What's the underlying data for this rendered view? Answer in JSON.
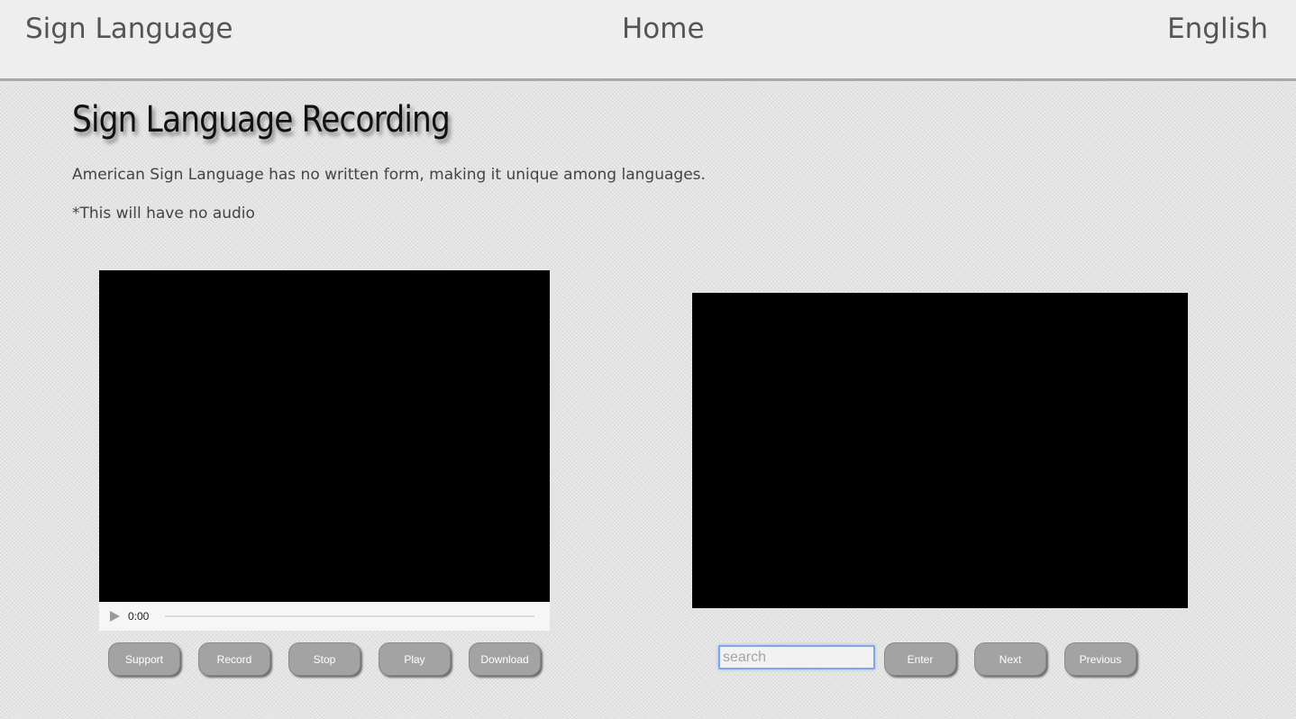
{
  "nav": {
    "brand": "Sign Language",
    "home": "Home",
    "language": "English"
  },
  "header": {
    "title": "Sign Language Recording",
    "intro": "American Sign Language has no written form, making it unique among languages.",
    "note": "*This will have no audio"
  },
  "recorder": {
    "time": "0:00",
    "buttons": {
      "support": "Support",
      "record": "Record",
      "stop": "Stop",
      "play": "Play",
      "download": "Download"
    }
  },
  "viewer": {
    "search_placeholder": "search",
    "search_value": "",
    "buttons": {
      "enter": "Enter",
      "next": "Next",
      "previous": "Previous"
    }
  },
  "colors": {
    "button_bg": "#a3a3a3",
    "topbar_bg": "#eeeeee",
    "video_bg": "#000000",
    "search_focus": "#7fa8e6"
  }
}
